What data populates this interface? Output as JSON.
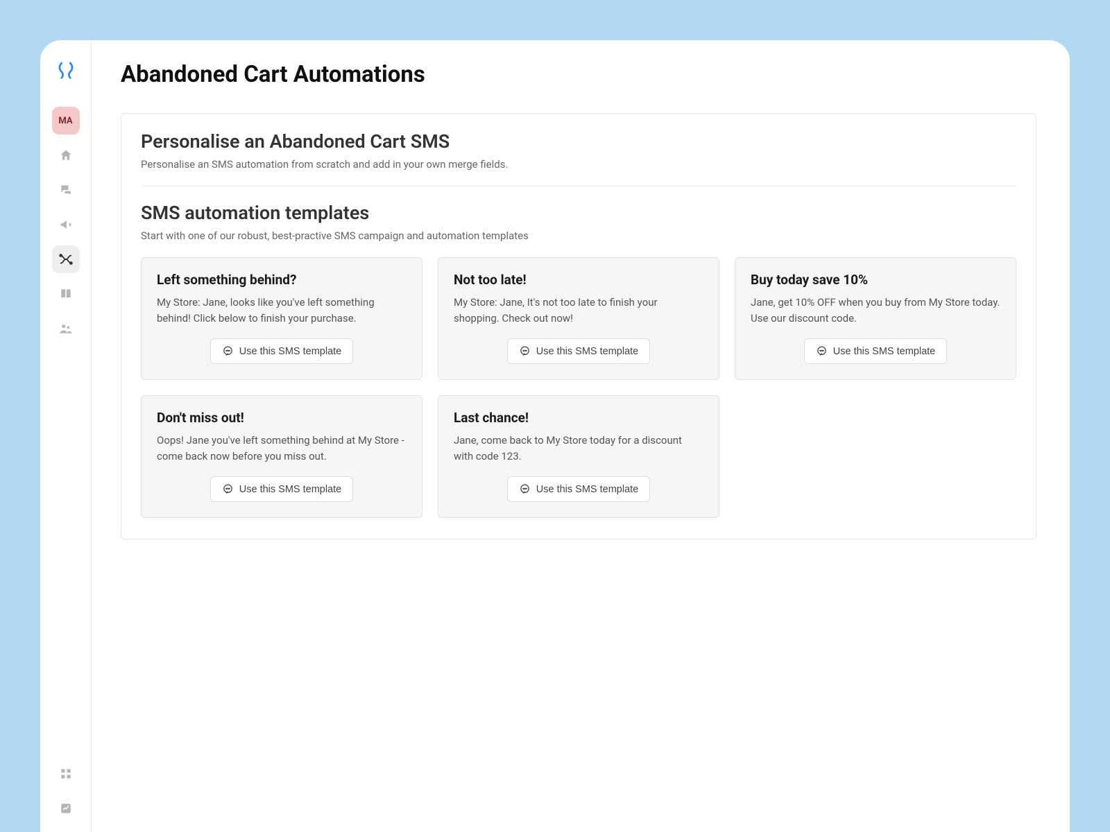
{
  "header": {
    "title": "Abandoned Cart Automations"
  },
  "sidebar": {
    "ma_label": "MA"
  },
  "panel": {
    "section1_title": "Personalise an Abandoned Cart SMS",
    "section1_sub": "Personalise an SMS automation from scratch and add in your own merge fields.",
    "section2_title": "SMS automation templates",
    "section2_sub": "Start with one of our robust, best-practive SMS campaign and automation templates",
    "use_label": "Use this SMS template"
  },
  "templates": [
    {
      "title": "Left something behind?",
      "body": "My Store: Jane, looks like you've left something behind! Click below to finish your purchase."
    },
    {
      "title": "Not too late!",
      "body": "My Store: Jane, It's not too late to finish your shopping. Check out now!"
    },
    {
      "title": "Buy today save 10%",
      "body": "Jane, get 10% OFF when you buy from My Store today. Use our discount code."
    },
    {
      "title": "Don't miss out!",
      "body": "Oops! Jane you've left something behind at My Store - come back now before you miss out."
    },
    {
      "title": "Last chance!",
      "body": "Jane, come back to My Store today for a discount with code 123."
    }
  ]
}
